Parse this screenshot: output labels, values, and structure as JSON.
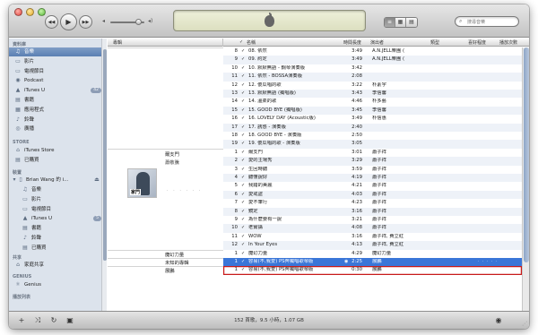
{
  "toolbar": {
    "search_placeholder": "搜尋音樂",
    "view_buttons": [
      "≡",
      "▦",
      "▤"
    ]
  },
  "sidebar": {
    "sections": {
      "library": "資料庫",
      "store": "STORE",
      "devices": "裝置",
      "shared": "共享",
      "genius": "GENIUS",
      "playlists": "播放列表"
    },
    "library_items": [
      {
        "label": "音樂",
        "icon": "music-note-icon"
      },
      {
        "label": "影片",
        "icon": "film-icon"
      },
      {
        "label": "電視節目",
        "icon": "tv-icon"
      },
      {
        "label": "Podcast",
        "icon": "podcast-icon"
      },
      {
        "label": "iTunes U",
        "icon": "graduation-cap-icon",
        "badge": "42"
      },
      {
        "label": "書籍",
        "icon": "book-icon"
      },
      {
        "label": "應用程式",
        "icon": "apps-icon"
      },
      {
        "label": "鈴聲",
        "icon": "bell-icon"
      },
      {
        "label": "廣播",
        "icon": "radio-icon"
      }
    ],
    "store_items": [
      {
        "label": "iTunes Store",
        "icon": "store-icon"
      },
      {
        "label": "已購買",
        "icon": "purchased-icon"
      }
    ],
    "device_name": "Brian Wang 的 i...",
    "device_items": [
      {
        "label": "音樂",
        "icon": "music-note-icon"
      },
      {
        "label": "影片",
        "icon": "film-icon"
      },
      {
        "label": "電視節目",
        "icon": "tv-icon"
      },
      {
        "label": "iTunes U",
        "icon": "graduation-cap-icon",
        "badge": "5"
      },
      {
        "label": "書籍",
        "icon": "book-icon"
      },
      {
        "label": "鈴聲",
        "icon": "bell-icon"
      },
      {
        "label": "已購買",
        "icon": "purchased-icon"
      }
    ],
    "shared_items": [
      {
        "label": "家庭共享",
        "icon": "home-icon"
      }
    ],
    "genius_items": [
      {
        "label": "Genius",
        "icon": "genius-icon"
      }
    ]
  },
  "columns": {
    "album": "專輯",
    "name": "名稱",
    "time": "時間長度",
    "artist": "演出者",
    "genre": "類型",
    "rating": "喜好程度",
    "plays": "播放次數"
  },
  "tracks_group1": [
    {
      "num": "8",
      "name": "08. 依然",
      "time": "3:49",
      "artist": "A.N.JELL樂團 (張根..."
    },
    {
      "num": "9",
      "name": "09. 約定",
      "time": "3:49",
      "artist": "A.N.JELL樂團 (張根..."
    },
    {
      "num": "10",
      "name": "10. 默默無語 - 鋼琴演奏版",
      "time": "3:42",
      "artist": ""
    },
    {
      "num": "11",
      "name": "11. 依然 - BOSSA演奏版",
      "time": "2:08",
      "artist": ""
    },
    {
      "num": "12",
      "name": "12. 傻瓜唱的歌",
      "time": "3:22",
      "artist": "朴素宇"
    },
    {
      "num": "13",
      "name": "13. 默默無語 (獨唱版)",
      "time": "3:43",
      "artist": "李信馨"
    },
    {
      "num": "14",
      "name": "14. 溫柔的歌",
      "time": "4:46",
      "artist": "朴多藝"
    },
    {
      "num": "15",
      "name": "15. GOOD BYE (獨唱版)",
      "time": "3:45",
      "artist": "李信馨"
    },
    {
      "num": "16",
      "name": "16. LOVELY DAY (Acoustic版)",
      "time": "3:49",
      "artist": "朴信惠"
    },
    {
      "num": "17",
      "name": "17. 誘惑 - 演奏版",
      "time": "2:40",
      "artist": ""
    },
    {
      "num": "18",
      "name": "18. GOOD BYE - 演奏版",
      "time": "2:50",
      "artist": ""
    },
    {
      "num": "19",
      "name": "19. 傻瓜唱的歌 - 演奏版",
      "time": "3:05",
      "artist": ""
    }
  ],
  "album2": {
    "title": "爾支門",
    "artist": "蕭敬騰",
    "dots": "· · · · · ·",
    "cover_text": "家門"
  },
  "tracks_group2": [
    {
      "num": "1",
      "name": "爾支門",
      "time": "3:01",
      "artist": "蕭子祥"
    },
    {
      "num": "2",
      "name": "愛的主場秀",
      "time": "3:29",
      "artist": "蕭子祥"
    },
    {
      "num": "3",
      "name": "生回時聽",
      "time": "3:59",
      "artist": "蕭子祥"
    },
    {
      "num": "4",
      "name": "聽懂說好",
      "time": "4:19",
      "artist": "蕭子祥"
    },
    {
      "num": "5",
      "name": "我錯的美麗",
      "time": "4:21",
      "artist": "蕭子祥"
    },
    {
      "num": "6",
      "name": "愛戒盜",
      "time": "4:03",
      "artist": "蕭子祥"
    },
    {
      "num": "7",
      "name": "愛不筆行",
      "time": "4:23",
      "artist": "蕭子祥"
    },
    {
      "num": "8",
      "name": "鏡定",
      "time": "3:16",
      "artist": "蕭子祥"
    },
    {
      "num": "9",
      "name": "為什麼要有一說",
      "time": "3:21",
      "artist": "蕭子祥"
    },
    {
      "num": "10",
      "name": "老實講",
      "time": "4:08",
      "artist": "蕭子祥"
    },
    {
      "num": "11",
      "name": "WOW",
      "time": "3:16",
      "artist": "蕭子祥, 費立紅"
    },
    {
      "num": "12",
      "name": "In Your Eyes",
      "time": "4:13",
      "artist": "蕭子祥, 費立紅"
    }
  ],
  "single_rows": [
    {
      "album": "魔幻力量",
      "num": "1",
      "name": "魔幻力量",
      "time": "4:29",
      "artist": "魔幻力量"
    },
    {
      "album": "未知的專輯",
      "num": "1",
      "name": "容易(不,我爱) PS奔獨唱歌琴版",
      "time": "2:25",
      "artist": "展鵬",
      "playing": true,
      "stars": "· · · · ·"
    },
    {
      "album": "展鵬",
      "num": "1",
      "name": "容易(不,我爱) PS奔獨唱歌琴版",
      "time": "0:30",
      "artist": "展鵬"
    }
  ],
  "status": "152 首歌，9.5 小時，1.07 GB",
  "colors": {
    "accent": "#3a76d8",
    "highlight_outline": "#c81a1a",
    "sidebar_bg": "#dce3ec"
  }
}
